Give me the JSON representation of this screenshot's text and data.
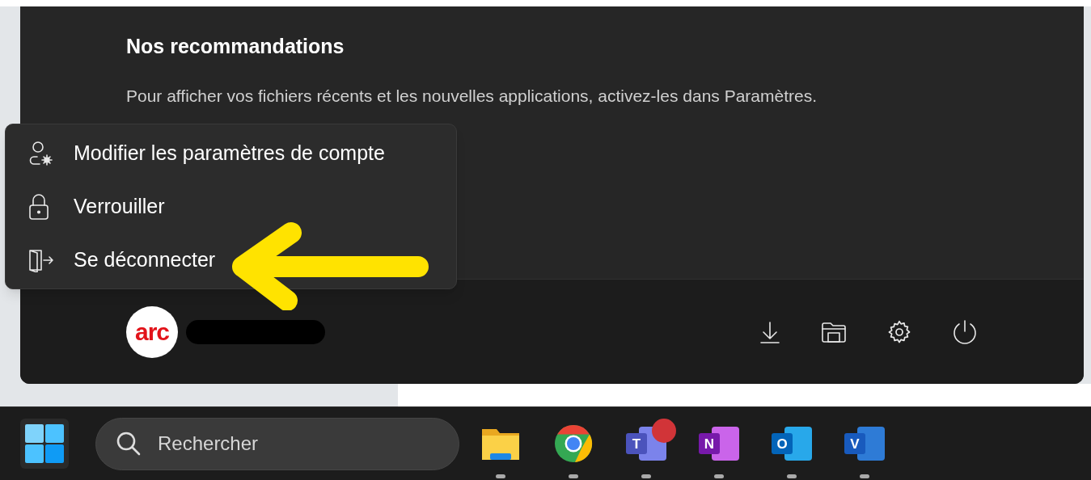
{
  "start_menu": {
    "heading": "Nos recommandations",
    "message": "Pour afficher vos fichiers récents et les nouvelles applications, activez-les dans Paramètres.",
    "account": {
      "avatar_text": "arc"
    },
    "quick_actions": [
      {
        "kind": "download"
      },
      {
        "kind": "folder"
      },
      {
        "kind": "settings"
      },
      {
        "kind": "power"
      }
    ]
  },
  "account_menu": [
    {
      "kind": "account-settings",
      "label": "Modifier les paramètres de compte"
    },
    {
      "kind": "lock",
      "label": "Verrouiller"
    },
    {
      "kind": "sign-out",
      "label": "Se déconnecter"
    }
  ],
  "taskbar": {
    "search": {
      "placeholder": "Rechercher"
    },
    "apps": [
      {
        "kind": "files",
        "notification": false
      },
      {
        "kind": "browser",
        "notification": false
      },
      {
        "kind": "teams",
        "letter": "T",
        "notification": true
      },
      {
        "kind": "notes",
        "letter": "N",
        "notification": false
      },
      {
        "kind": "mail",
        "letter": "O",
        "notification": false
      },
      {
        "kind": "visio",
        "letter": "V",
        "notification": false
      }
    ]
  }
}
